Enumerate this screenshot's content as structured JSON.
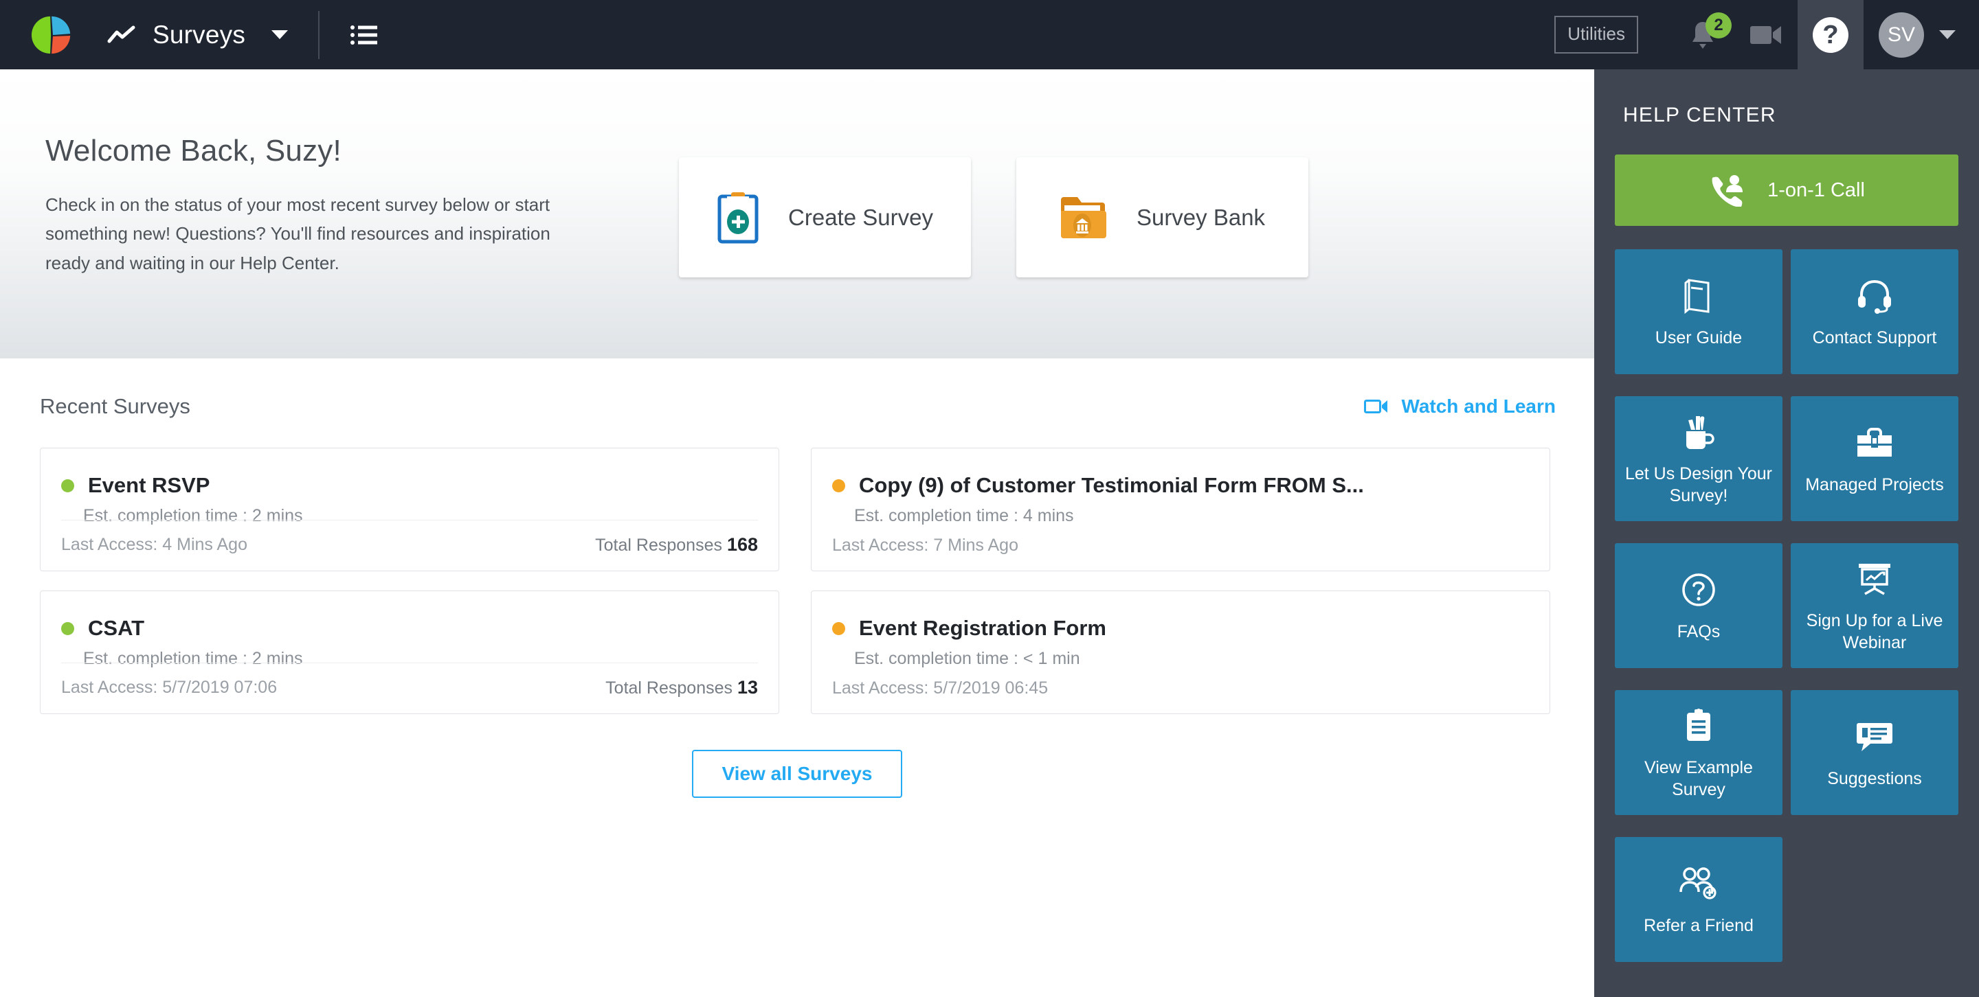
{
  "topbar": {
    "logo_icon": "pie-chart-logo",
    "trend_icon": "trend-line-icon",
    "module_name": "Surveys",
    "module_caret_icon": "chevron-down-icon",
    "list_icon": "list-menu-icon",
    "utilities_label": "Utilities",
    "bell_icon": "bell-icon",
    "notification_count": "2",
    "video_icon": "video-camera-icon",
    "help_icon": "question-mark-icon",
    "avatar_initials": "SV",
    "avatar_caret_icon": "chevron-down-icon"
  },
  "hero": {
    "title": "Welcome Back, Suzy!",
    "subtitle": "Check in on the status of your most recent survey below or start something new! Questions? You'll find resources and inspiration ready and waiting in our Help Center.",
    "actions": [
      {
        "label": "Create Survey",
        "icon": "clipboard-plus-icon"
      },
      {
        "label": "Survey Bank",
        "icon": "folder-bank-icon"
      }
    ]
  },
  "recent": {
    "title": "Recent Surveys",
    "watch_label": "Watch and Learn",
    "watch_icon": "video-camera-icon",
    "view_all_label": "View all Surveys",
    "responses_label": "Total Responses",
    "surveys": [
      {
        "name": "Event RSVP",
        "status_color": "#8cc63f",
        "est": "Est. completion time : 2 mins",
        "last_access": "Last Access: 4 Mins Ago",
        "responses": "168",
        "has_responses": true
      },
      {
        "name": "Copy (9) of Customer Testimonial Form FROM S...",
        "status_color": "#f5a623",
        "est": "Est. completion time : 4 mins",
        "last_access": "Last Access: 7 Mins Ago",
        "responses": "",
        "has_responses": false
      },
      {
        "name": "CSAT",
        "status_color": "#8cc63f",
        "est": "Est. completion time : 2 mins",
        "last_access": "Last Access: 5/7/2019 07:06",
        "responses": "13",
        "has_responses": true
      },
      {
        "name": "Event Registration Form",
        "status_color": "#f5a623",
        "est": "Est. completion time : < 1 min",
        "last_access": "Last Access: 5/7/2019 06:45",
        "responses": "",
        "has_responses": false
      }
    ]
  },
  "help_panel": {
    "header": "HELP CENTER",
    "call_button": {
      "label": "1-on-1 Call",
      "icon": "phone-person-icon"
    },
    "tiles": [
      {
        "label": "User Guide",
        "icon": "book-icon"
      },
      {
        "label": "Contact Support",
        "icon": "headset-icon"
      },
      {
        "label": "Let Us Design Your Survey!",
        "icon": "mug-pencils-icon"
      },
      {
        "label": "Managed Projects",
        "icon": "briefcase-icon"
      },
      {
        "label": "FAQs",
        "icon": "question-circle-icon"
      },
      {
        "label": "Sign Up for a Live Webinar",
        "icon": "presentation-chart-icon"
      },
      {
        "label": "View Example Survey",
        "icon": "clipboard-list-icon"
      },
      {
        "label": "Suggestions",
        "icon": "speech-bubble-icon"
      },
      {
        "label": "Refer a Friend",
        "icon": "people-add-icon"
      }
    ]
  },
  "colors": {
    "topbar_bg": "#1e2430",
    "help_panel_bg": "#3f4551",
    "tile_bg": "#2678a0",
    "call_green": "#77b143",
    "link_blue": "#23aaf2",
    "status_green": "#8cc63f",
    "status_amber": "#f5a623"
  }
}
